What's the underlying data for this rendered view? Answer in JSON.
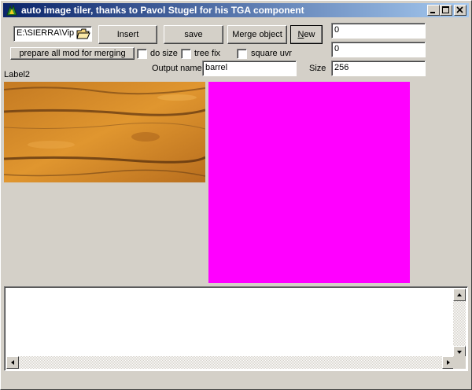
{
  "window": {
    "title": "auto image tiler, thanks to Pavol Stugel for his TGA component",
    "icons": [
      "app-icon",
      "minimize-icon",
      "maximize-icon",
      "close-icon"
    ]
  },
  "toolbar": {
    "path_value": "E:\\SIERRA\\Vip",
    "folder_icon": "folder-open-icon",
    "insert_label": "Insert",
    "save_label": "save",
    "merge_label": "Merge object",
    "new_label_underlined": "N",
    "new_label_rest": "ew",
    "prepare_label": "prepare all mod for merging"
  },
  "checkboxes": {
    "do_size": "do size",
    "tree_fix": "tree fix",
    "square_uvr": "square uvr"
  },
  "fields": {
    "value1": "0",
    "value2": "0",
    "output_name_label": "Output name",
    "output_name_value": "barrel",
    "size_label": "Size",
    "size_value": "256"
  },
  "label2": "Label2",
  "colors": {
    "title_start": "#0a246a",
    "title_end": "#a6caf0",
    "face": "#d4d0c8",
    "placeholder": "#ff00ff",
    "wood": "#d98a2b"
  },
  "memo": {
    "text": ""
  }
}
